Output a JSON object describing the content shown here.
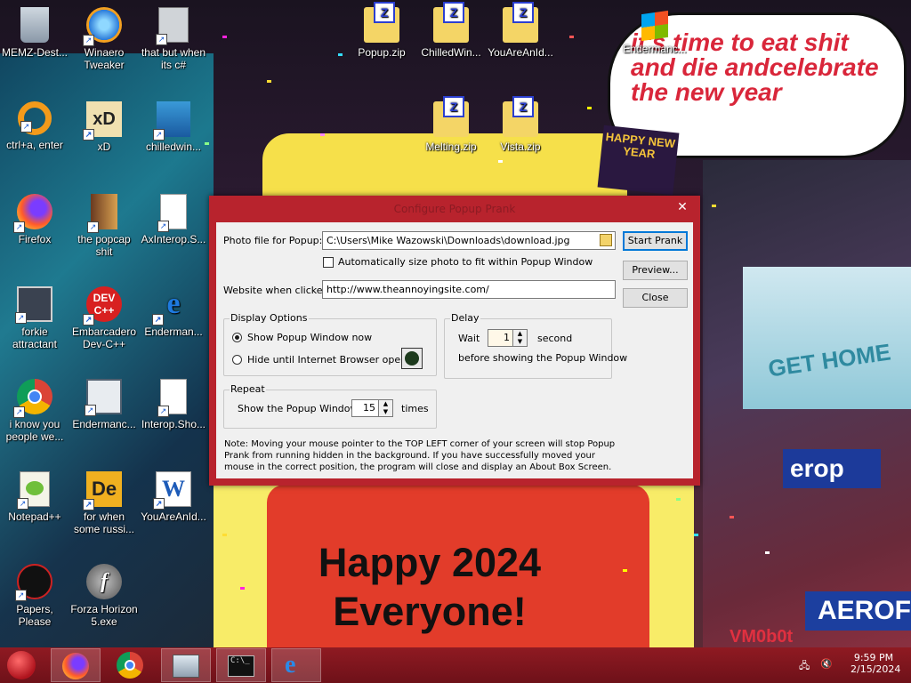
{
  "desktop_icons": [
    {
      "id": "memz",
      "label": "MEMZ-Dest..."
    },
    {
      "id": "winaero",
      "label": "Winaero Tweaker"
    },
    {
      "id": "thatbut",
      "label": "that but when its c#"
    },
    {
      "id": "popupzip",
      "label": "Popup.zip"
    },
    {
      "id": "chilledzip",
      "label": "ChilledWin..."
    },
    {
      "id": "youarezip",
      "label": "YouAreAnId..."
    },
    {
      "id": "enderman1",
      "label": "Endermanc..."
    },
    {
      "id": "ctrla",
      "label": "ctrl+a, enter"
    },
    {
      "id": "xd",
      "label": "xD"
    },
    {
      "id": "chilledwin",
      "label": "chilledwin..."
    },
    {
      "id": "meltingzip",
      "label": "Melting.zip"
    },
    {
      "id": "vistazip",
      "label": "Vista.zip"
    },
    {
      "id": "firefox",
      "label": "Firefox"
    },
    {
      "id": "popcap",
      "label": "the popcap shit"
    },
    {
      "id": "axinterop",
      "label": "AxInterop.S..."
    },
    {
      "id": "forkie",
      "label": "forkie attractant"
    },
    {
      "id": "devcpp",
      "label": "Embarcadero Dev-C++"
    },
    {
      "id": "enderman2",
      "label": "Enderman..."
    },
    {
      "id": "chrome",
      "label": "i know you people we..."
    },
    {
      "id": "enderman3",
      "label": "Endermanc..."
    },
    {
      "id": "interop",
      "label": "Interop.Sho..."
    },
    {
      "id": "notepadpp",
      "label": "Notepad++"
    },
    {
      "id": "forwhen",
      "label": "for when some russi..."
    },
    {
      "id": "word",
      "label": "YouAreAnId..."
    },
    {
      "id": "papers",
      "label": "Papers, Please"
    },
    {
      "id": "forza",
      "label": "Forza Horizon 5.exe"
    }
  ],
  "wallpaper": {
    "bubble_text": "it's time to eat shit and die andcelebrate the new year",
    "happy_text_line1": "Happy 2024",
    "happy_text_line2": "Everyone!",
    "happy_sign": "HAPPY NEW YEAR",
    "screen_text": "GET HOME",
    "erop_text": "erop",
    "aerofs_text": "AEROFS",
    "watermark": "VM0b0t"
  },
  "dialog": {
    "title": "Configure Popup Prank",
    "close_glyph": "✕",
    "photo_label": "Photo file for Popup:",
    "photo_value": "C:\\Users\\Mike Wazowski\\Downloads\\download.jpg",
    "autosize_label": "Automatically size photo to fit within Popup Window",
    "autosize_checked": false,
    "website_label": "Website when clicked:",
    "website_value": "http://www.theannoyingsite.com/",
    "buttons": {
      "start": "Start Prank",
      "preview": "Preview...",
      "close": "Close"
    },
    "display_options": {
      "title": "Display Options",
      "show_now": "Show Popup Window now",
      "hide_until": "Hide until Internet Browser opens",
      "selected": "show_now"
    },
    "delay": {
      "title": "Delay",
      "wait_label": "Wait",
      "wait_value": "1",
      "unit": "second",
      "after": "before showing the Popup Window"
    },
    "repeat": {
      "title": "Repeat",
      "label": "Show the Popup Window",
      "value": "15",
      "unit": "times"
    },
    "note": "Note: Moving your mouse pointer to the TOP LEFT corner of your screen will stop Popup Prank from running hidden in the background. If you have successfully moved your mouse in the correct position, the program will close and display an About Box Screen."
  },
  "taskbar": {
    "apps": [
      {
        "name": "Firefox",
        "active": true
      },
      {
        "name": "Chrome",
        "active": false
      },
      {
        "name": "Control Panel",
        "active": false
      },
      {
        "name": "Command Prompt",
        "active": false
      },
      {
        "name": "Internet Explorer",
        "active": true
      }
    ],
    "time": "9:59 PM",
    "date": "2/15/2024"
  },
  "colors": {
    "accent": "#b8232d",
    "taskbar": "#7a141c",
    "bubble_text": "#d9263a"
  }
}
